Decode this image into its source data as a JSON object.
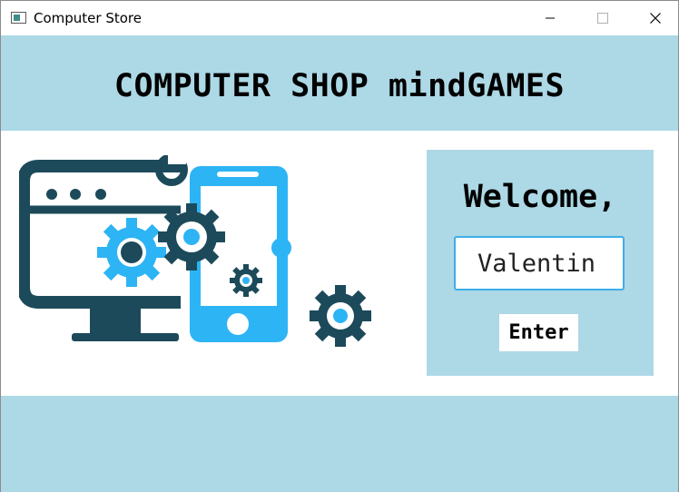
{
  "window": {
    "title": "Computer Store",
    "icons": {
      "app": "app-window-icon",
      "minimize": "minimize-icon",
      "maximize": "maximize-icon",
      "close": "close-icon"
    }
  },
  "header": {
    "title": "COMPUTER SHOP mindGAMES"
  },
  "illustration": {
    "icons": [
      "computer-monitor-icon",
      "smartphone-icon",
      "gear-icon",
      "wrench-icon"
    ]
  },
  "login": {
    "welcome": "Welcome,",
    "name_value": "Valentin",
    "enter_label": "Enter"
  },
  "colors": {
    "band": "#add8e6",
    "dark": "#1c4a5a",
    "accent": "#2db4f5",
    "input_border": "#3daee9"
  }
}
